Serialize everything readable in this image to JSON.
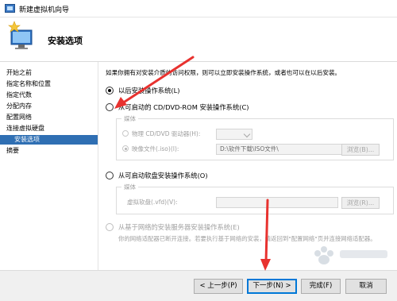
{
  "window": {
    "title": "新建虚拟机向导"
  },
  "header": {
    "title": "安装选项"
  },
  "sidebar": {
    "items": [
      {
        "label": "开始之前"
      },
      {
        "label": "指定名称和位置"
      },
      {
        "label": "指定代数"
      },
      {
        "label": "分配内存"
      },
      {
        "label": "配置网络"
      },
      {
        "label": "连接虚拟硬盘"
      },
      {
        "label": "安装选项"
      },
      {
        "label": "摘要"
      }
    ]
  },
  "main": {
    "description": "如果你拥有对安装介质的访问权限，则可以立即安装操作系统，或者也可以在以后安装。",
    "option_later": "以后安装操作系统(L)",
    "option_cd": "从可启动的 CD/DVD-ROM 安装操作系统(C)",
    "cd_group": {
      "legend": "媒体",
      "physical_label": "物理 CD/DVD 驱动器(H):",
      "physical_value": "",
      "image_label": "映像文件(.iso)(I):",
      "image_value": "D:\\软件下载\\ISO文件\\",
      "browse_label": "浏览(B)..."
    },
    "option_floppy": "从可启动软盘安装操作系统(O)",
    "floppy_group": {
      "legend": "媒体",
      "vfd_label": "虚拟软盘(.vfd)(V):",
      "vfd_value": "",
      "browse_label": "浏览(R)..."
    },
    "option_network": "从基于网络的安装服务器安装操作系统(E)",
    "network_note": "你的网络适配器已断开连接。若要执行基于网络的安装，请返回到\"配置网络\"页并连接网络适配器。"
  },
  "buttons": {
    "prev": "< 上一步(P)",
    "next": "下一步(N) >",
    "finish": "完成(F)",
    "cancel": "取消"
  },
  "colors": {
    "accent": "#2f6fb3",
    "annotation_arrow": "#e8322f"
  }
}
